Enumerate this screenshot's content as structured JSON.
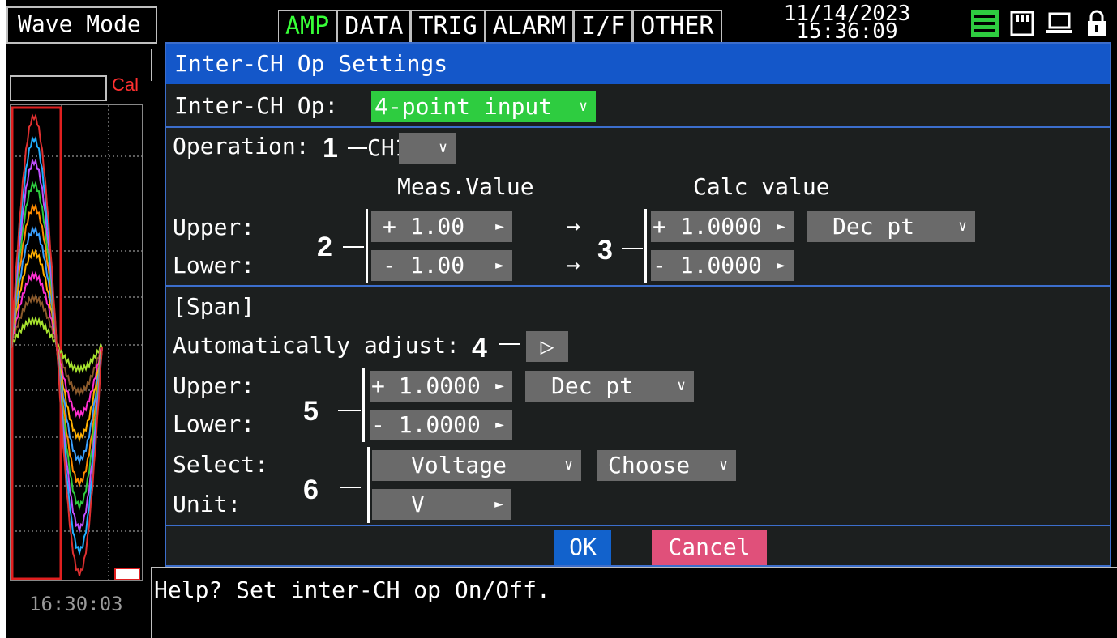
{
  "window": {
    "mode_title": "Wave Mode"
  },
  "tabs": [
    {
      "label": "AMP",
      "active": true
    },
    {
      "label": "DATA",
      "active": false
    },
    {
      "label": "TRIG",
      "active": false
    },
    {
      "label": "ALARM",
      "active": false
    },
    {
      "label": "I/F",
      "active": false
    },
    {
      "label": "OTHER",
      "active": false
    }
  ],
  "status": {
    "date": "11/14/2023",
    "time": "15:36:09"
  },
  "icons": [
    "list-icon",
    "memory-card-icon",
    "pc-icon",
    "lock-icon"
  ],
  "left_panel": {
    "cal_label": "Cal",
    "time": "16:30:03"
  },
  "dialog": {
    "title": "Inter-CH Op Settings",
    "inter_ch_op": {
      "label": "Inter-CH Op:",
      "value": "4-point input"
    },
    "operation": {
      "label": "Operation:",
      "value": "CH1"
    },
    "headers": {
      "meas": "Meas.Value",
      "calc": "Calc value"
    },
    "upper_label": "Upper:",
    "lower_label": "Lower:",
    "meas_upper": "+  1.00",
    "meas_lower": "-  1.00",
    "calc_upper": "+ 1.0000",
    "calc_lower": "- 1.0000",
    "calc_format": "Dec pt",
    "span": {
      "heading": "[Span]",
      "auto_label": "Automatically adjust:",
      "upper_label": "Upper:",
      "lower_label": "Lower:",
      "upper": "+ 1.0000",
      "lower": "- 1.0000",
      "format": "Dec pt",
      "select_label": "Select:",
      "unit_label": "Unit:",
      "select_value": "Voltage",
      "choose_value": "Choose",
      "unit_value": "V"
    },
    "callouts": [
      "1",
      "2",
      "3",
      "4",
      "5",
      "6"
    ],
    "ok": "OK",
    "cancel": "Cancel"
  },
  "help": "Help?  Set inter-CH op On/Off.",
  "colors": {
    "accent_green": "#2ecc40",
    "title_blue": "#1457c9",
    "ok_blue": "#1262cc",
    "cancel_pink": "#e0507a",
    "field_gray": "#6a6a6a"
  }
}
